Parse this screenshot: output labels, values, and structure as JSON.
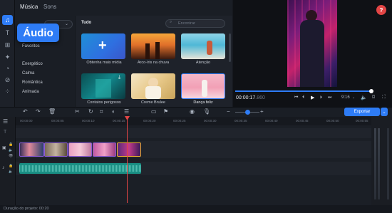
{
  "tabs": {
    "music": "Música",
    "sounds": "Sons"
  },
  "tooltip": "Áudio",
  "categories": [
    "Favoritos",
    "Energético",
    "Calma",
    "Romântica",
    "Animada"
  ],
  "grid": {
    "section": "Tudo",
    "search_placeholder": "Encontrar",
    "tiles": [
      {
        "label": "Obtenha mais mídia"
      },
      {
        "label": "Arco-íris na chuva"
      },
      {
        "label": "Atenção"
      },
      {
        "label": "Contatos perigosos"
      },
      {
        "label": "Creme Brulee"
      },
      {
        "label": "Dança feliz"
      }
    ]
  },
  "preview": {
    "timecode_main": "00:00:17",
    "timecode_frac": ".860",
    "aspect": "9:16",
    "help": "?"
  },
  "toolbar": {
    "export_label": "Exportar"
  },
  "ruler": [
    "00:00:00",
    "00:00:05",
    "00:00:10",
    "00:00:15",
    "00:00:20",
    "00:00:25",
    "00:00:30",
    "00:00:35",
    "00:00:40",
    "00:00:45",
    "00:00:50",
    "00:00:55"
  ],
  "status": {
    "duration": "Duração do projeto: 00:20"
  },
  "colors": {
    "accent": "#2e7cf6",
    "playhead": "#e24545",
    "audio": "#1a8f84",
    "clip_border": "#8a5bd6"
  }
}
